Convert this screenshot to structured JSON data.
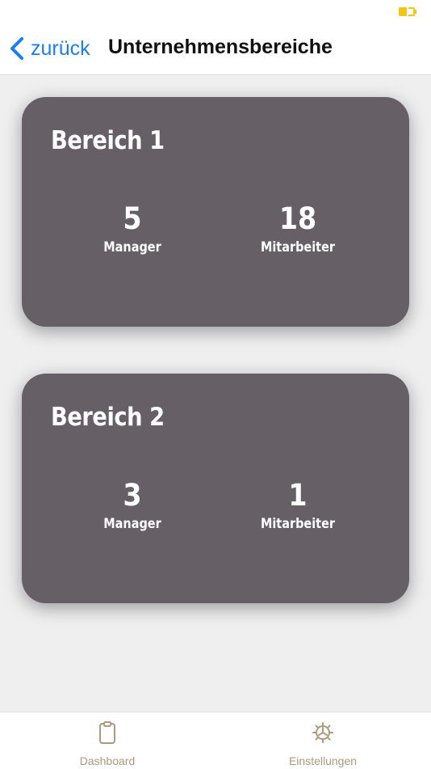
{
  "nav": {
    "back_label": "zurück",
    "title": "Unternehmensbereiche"
  },
  "sections": [
    {
      "title": "Bereich 1",
      "stats": [
        {
          "value": "5",
          "label": "Manager"
        },
        {
          "value": "18",
          "label": "Mitarbeiter"
        }
      ]
    },
    {
      "title": "Bereich 2",
      "stats": [
        {
          "value": "3",
          "label": "Manager"
        },
        {
          "value": "1",
          "label": "Mitarbeiter"
        }
      ]
    }
  ],
  "tab_bar": {
    "tabs": [
      {
        "label": "Dashboard",
        "icon": "clipboard-icon"
      },
      {
        "label": "Einstellungen",
        "icon": "gear-icon"
      }
    ]
  },
  "colors": {
    "accent": "#1a7ef2",
    "card_background": "#665f66",
    "tab_tint": "#ad9a7d",
    "battery": "#f5c518"
  }
}
